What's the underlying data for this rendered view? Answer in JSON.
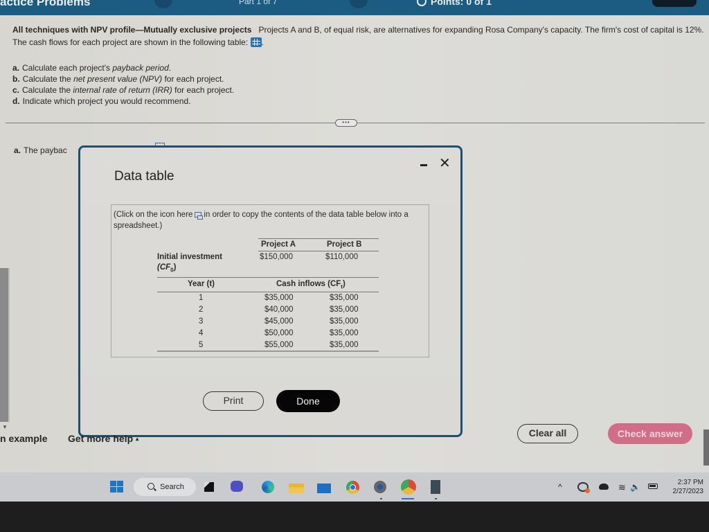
{
  "header": {
    "title_partial": "actice Problems",
    "part": "Part 1 of 7",
    "points": "Points: 0 of 1"
  },
  "question": {
    "heading": "All techniques with NPV profile—Mutually exclusive projects",
    "body": "Projects A and B, of equal risk, are alternatives for expanding Rosa Company's capacity.  The firm's cost of capital is 12%.  The cash flows for each project are shown in the following table:",
    "trailing": ".",
    "table_icon": "data-table-grid-icon"
  },
  "tasks": [
    {
      "letter": "a.",
      "pre": "Calculate each project's ",
      "em": "payback period",
      "post": "."
    },
    {
      "letter": "b.",
      "pre": "Calculate the ",
      "em": "net present value (NPV)",
      "post": " for each project."
    },
    {
      "letter": "c.",
      "pre": "Calculate the ",
      "em": "internal rate of return (IRR)",
      "post": " for each project."
    },
    {
      "letter": "d.",
      "pre": "Indicate which project you would recommend.",
      "em": "",
      "post": ""
    }
  ],
  "more_button": "•••",
  "answer_a": {
    "letter": "a.",
    "text": "The paybac"
  },
  "modal": {
    "title": "Data table",
    "minimize": "minimize",
    "close": "✕",
    "note_pre": "(Click on the icon here",
    "note_post": "in order to copy the contents of the data table below into a spreadsheet.)",
    "table": {
      "col_a": "Project A",
      "col_b": "Project B",
      "initial_label": "Initial investment",
      "initial_sub": "(CF",
      "initial_sub_idx": "0",
      "initial_sub_close": ")",
      "initial_a": "$150,000",
      "initial_b": "$110,000",
      "year_label": "Year (t)",
      "inflows_label": "Cash inflows (CF",
      "inflows_idx": "t",
      "inflows_close": ")",
      "rows": [
        {
          "year": "1",
          "a": "$35,000",
          "b": "$35,000"
        },
        {
          "year": "2",
          "a": "$40,000",
          "b": "$35,000"
        },
        {
          "year": "3",
          "a": "$45,000",
          "b": "$35,000"
        },
        {
          "year": "4",
          "a": "$50,000",
          "b": "$35,000"
        },
        {
          "year": "5",
          "a": "$55,000",
          "b": "$35,000"
        }
      ]
    },
    "print_label": "Print",
    "done_label": "Done"
  },
  "footer": {
    "example_link": "n example",
    "help_link": "Get more help",
    "help_caret": "▴",
    "clear_all": "Clear all",
    "check_answer": "Check answer",
    "check_color": "#cf6e86"
  },
  "taskbar": {
    "search_label": "Search",
    "apps": [
      "windows-start",
      "task-view",
      "teams-meet",
      "edge",
      "file-explorer",
      "mail",
      "chrome",
      "settings",
      "chrome-profile",
      "calculator"
    ],
    "tray": {
      "chevron": "^",
      "wifi": "wifi",
      "volume": "🔈"
    },
    "time": "2:37 PM",
    "date": "2/27/2023"
  }
}
